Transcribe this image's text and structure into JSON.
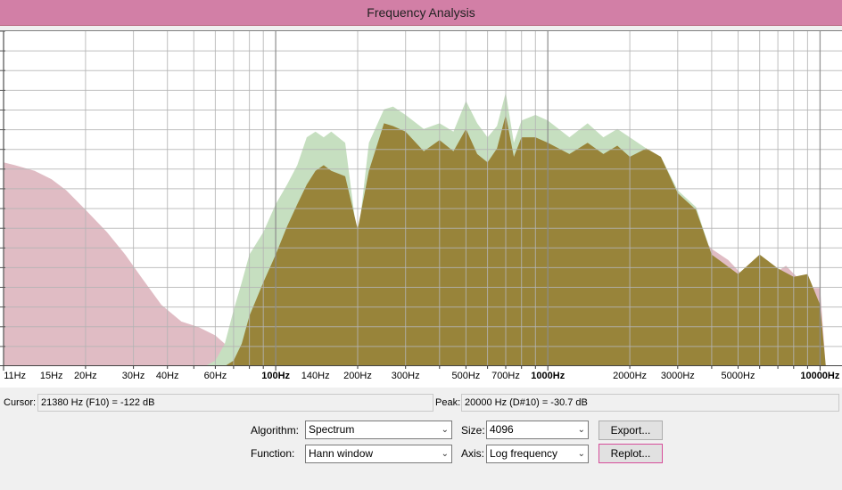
{
  "window": {
    "title": "Frequency Analysis"
  },
  "colors": {
    "titlebar": "#d27fa6",
    "spectrum_pink": "#e0bcc4",
    "spectrum_green": "#c6dfc0",
    "spectrum_olive": "#98843a",
    "grid": "#b4b4b4"
  },
  "chart_data": {
    "type": "area",
    "xscale": "log",
    "xlim": [
      10,
      11000
    ],
    "ylim": [
      -120,
      0
    ],
    "tick_labels": [
      {
        "hz": 11,
        "label": "11Hz"
      },
      {
        "hz": 15,
        "label": "15Hz"
      },
      {
        "hz": 20,
        "label": "20Hz"
      },
      {
        "hz": 30,
        "label": "30Hz"
      },
      {
        "hz": 40,
        "label": "40Hz"
      },
      {
        "hz": 60,
        "label": "60Hz"
      },
      {
        "hz": 100,
        "label": "100Hz",
        "major": true
      },
      {
        "hz": 140,
        "label": "140Hz"
      },
      {
        "hz": 200,
        "label": "200Hz"
      },
      {
        "hz": 300,
        "label": "300Hz"
      },
      {
        "hz": 500,
        "label": "500Hz"
      },
      {
        "hz": 700,
        "label": "700Hz"
      },
      {
        "hz": 1000,
        "label": "1000Hz",
        "major": true
      },
      {
        "hz": 2000,
        "label": "2000Hz"
      },
      {
        "hz": 3000,
        "label": "3000Hz"
      },
      {
        "hz": 5000,
        "label": "5000Hz"
      },
      {
        "hz": 10000,
        "label": "10000Hz",
        "major": true
      }
    ],
    "series": [
      {
        "color": "#e0bcc4",
        "x": [
          10,
          11,
          13,
          15,
          17,
          20,
          24,
          28,
          32,
          38,
          45,
          52,
          60,
          65,
          70,
          75,
          80,
          90,
          100,
          120,
          140,
          160,
          180,
          200,
          250,
          300,
          400,
          500,
          600,
          700,
          800,
          1000,
          1300,
          1600,
          2000,
          2300,
          2500,
          2700,
          3000,
          3400,
          4000,
          4600,
          5500,
          6500,
          7500,
          9000,
          10000,
          10500
        ],
        "y": [
          -47,
          -48,
          -50,
          -53,
          -57,
          -64,
          -72,
          -80,
          -88,
          -98,
          -104,
          -106,
          -109,
          -112,
          -115,
          -118,
          -118,
          -97,
          -80,
          -62,
          -54,
          -54,
          -56,
          -72,
          -50,
          -40,
          -48,
          -45,
          -40,
          -45,
          -48,
          -45,
          -52,
          -50,
          -55,
          -47,
          -48,
          -52,
          -60,
          -70,
          -78,
          -82,
          -90,
          -88,
          -84,
          -92,
          -92,
          -120
        ]
      },
      {
        "color": "#c6dfc0",
        "x": [
          55,
          60,
          65,
          70,
          75,
          80,
          90,
          100,
          110,
          120,
          130,
          140,
          150,
          160,
          180,
          200,
          220,
          250,
          270,
          300,
          350,
          400,
          450,
          500,
          550,
          600,
          650,
          700,
          750,
          800,
          900,
          1000,
          1200,
          1400,
          1600,
          1800,
          2000,
          2300,
          2600,
          3000,
          3500,
          4000,
          5000,
          6000,
          7000,
          8000,
          9000,
          10000,
          10500
        ],
        "y": [
          -120,
          -118,
          -112,
          -100,
          -90,
          -80,
          -72,
          -62,
          -55,
          -48,
          -38,
          -36,
          -38,
          -36,
          -40,
          -75,
          -40,
          -28,
          -27,
          -30,
          -35,
          -33,
          -36,
          -25,
          -33,
          -38,
          -34,
          -22,
          -40,
          -32,
          -30,
          -32,
          -38,
          -33,
          -38,
          -35,
          -38,
          -42,
          -45,
          -57,
          -63,
          -80,
          -88,
          -80,
          -86,
          -90,
          -88,
          -100,
          -120
        ]
      },
      {
        "color": "#98843a",
        "x": [
          65,
          70,
          75,
          80,
          90,
          100,
          110,
          120,
          130,
          140,
          150,
          160,
          180,
          200,
          220,
          250,
          270,
          300,
          350,
          400,
          450,
          500,
          550,
          600,
          650,
          700,
          750,
          800,
          900,
          1000,
          1200,
          1400,
          1600,
          1800,
          2000,
          2300,
          2600,
          3000,
          3500,
          4000,
          5000,
          6000,
          7000,
          8000,
          9000,
          10000,
          10500
        ],
        "y": [
          -120,
          -118,
          -112,
          -102,
          -90,
          -80,
          -70,
          -62,
          -55,
          -50,
          -48,
          -50,
          -52,
          -71,
          -50,
          -33,
          -34,
          -36,
          -43,
          -39,
          -43,
          -35,
          -44,
          -47,
          -42,
          -30,
          -45,
          -38,
          -38,
          -40,
          -44,
          -40,
          -44,
          -41,
          -45,
          -42,
          -45,
          -58,
          -64,
          -80,
          -87,
          -80,
          -85,
          -88,
          -87,
          -98,
          -120
        ]
      }
    ]
  },
  "readouts": {
    "cursor_label": "Cursor:",
    "cursor_value": "21380 Hz (F10) = -122 dB",
    "peak_label": "Peak:",
    "peak_value": "20000 Hz (D#10) = -30.7 dB"
  },
  "controls": {
    "algorithm_label": "Algorithm:",
    "algorithm_value": "Spectrum",
    "function_label": "Function:",
    "function_value": "Hann window",
    "size_label": "Size:",
    "size_value": "4096",
    "axis_label": "Axis:",
    "axis_value": "Log frequency",
    "export_label": "Export...",
    "replot_label": "Replot..."
  }
}
